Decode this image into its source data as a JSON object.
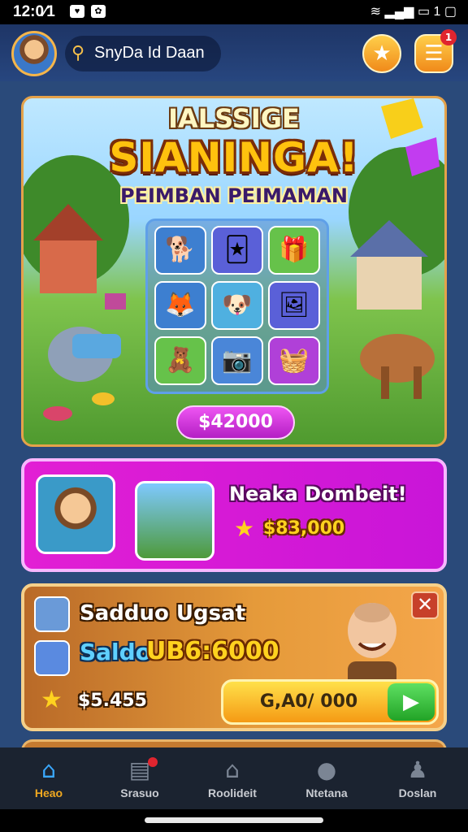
{
  "status_bar": {
    "time": "12:0⁄1",
    "battery": "1"
  },
  "header": {
    "location_name": "SnyDa Id Daan",
    "notifications": "1"
  },
  "hero": {
    "title_small": "IALSSIGE",
    "title_big": "SIANINGA!",
    "subtitle": "PEIMBAN PEIMAMAN",
    "price_button": "$42000",
    "grid_items": [
      "dog-icon",
      "card-icon",
      "gift-box-icon",
      "fox-icon",
      "puppy-icon",
      "frame-icon",
      "toy-box-icon",
      "camera-icon",
      "basket-icon"
    ]
  },
  "featured": {
    "name": "Neaka Dombeit!",
    "value": "$83,000"
  },
  "offer": {
    "heading": "Sadduo Ugsat",
    "saldo_label": "Saldo",
    "saldo_value": "UB6:6000",
    "amount": "$5.455",
    "buy_label": "G,A0/ 000"
  },
  "nav": {
    "items": [
      {
        "label": "Heao",
        "icon": "home-icon"
      },
      {
        "label": "Srasuo",
        "icon": "shop-icon"
      },
      {
        "label": "Roolideit",
        "icon": "house-icon"
      },
      {
        "label": "Ntetana",
        "icon": "pet-icon"
      },
      {
        "label": "Doslan",
        "icon": "profile-icon"
      }
    ]
  },
  "colors": {
    "accent": "#f0a820",
    "banner": "#d61ad6",
    "offer": "#e59a3a",
    "nav_bg": "#1b2330"
  }
}
